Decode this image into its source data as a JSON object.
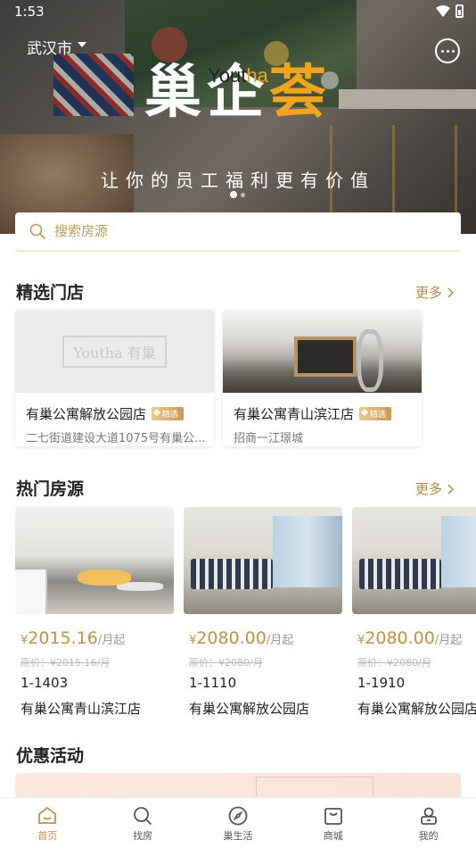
{
  "status_bar": {
    "time": "1:53"
  },
  "banner": {
    "city": "武汉市",
    "brand_main_a": "巢企",
    "brand_main_b": "荟",
    "brand_en_a": "Yout",
    "brand_en_b": "ha",
    "slogan": "让你的员工福利更有价值",
    "carousel_count": 2,
    "carousel_active": 1
  },
  "search": {
    "placeholder": "搜索房源"
  },
  "featured_stores": {
    "title": "精选门店",
    "more": "更多",
    "items": [
      {
        "name": "有巢公寓解放公园店",
        "badge": "精选",
        "address": "二七街道建设大道1075号有巢公...",
        "image_text": "Youtha 有巢"
      },
      {
        "name": "有巢公寓青山滨江店",
        "badge": "精选",
        "address": "招商一江璟城"
      }
    ]
  },
  "hot_rooms": {
    "title": "热门房源",
    "more": "更多",
    "items": [
      {
        "currency": "¥",
        "price": "2015.16",
        "unit": "/月起",
        "original": "原价：¥2015.16/月",
        "room": "1-1403",
        "store": "有巢公寓青山滨江店"
      },
      {
        "currency": "¥",
        "price": "2080.00",
        "unit": "/月起",
        "original": "原价：¥2080/月",
        "room": "1-1110",
        "store": "有巢公寓解放公园店"
      },
      {
        "currency": "¥",
        "price": "2080.00",
        "unit": "/月起",
        "original": "原价：¥2080/月",
        "room": "1-1910",
        "store": "有巢公寓解放公园店"
      }
    ]
  },
  "promotions": {
    "title": "优惠活动"
  },
  "tab_bar": {
    "items": [
      {
        "label": "首页",
        "icon": "home-icon",
        "active": true
      },
      {
        "label": "找房",
        "icon": "search-icon",
        "active": false
      },
      {
        "label": "巢生活",
        "icon": "compass-icon",
        "active": false
      },
      {
        "label": "商城",
        "icon": "shopping-bag-icon",
        "active": false
      },
      {
        "label": "我的",
        "icon": "profile-icon",
        "active": false
      }
    ]
  },
  "colors": {
    "accent": "#c49048",
    "brand_orange": "#f0a51e",
    "muted": "#999999"
  }
}
